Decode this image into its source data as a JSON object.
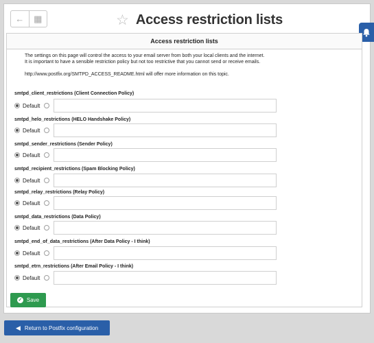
{
  "header": {
    "title": "Access restriction lists",
    "back_icon": "←",
    "grid_icon": "▦",
    "star_icon": "☆"
  },
  "colors": {
    "primary": "#2a5fa8",
    "success": "#2e9a4f"
  },
  "table": {
    "heading": "Access restriction lists",
    "intro": [
      "The settings on this page will control the access to your email server from both your local clients and the internet.",
      "It is important to have a sensible restriction policy but not too restrictive that you cannot send or receive emails."
    ],
    "readme": "http://www.postfix.org/SMTPD_ACCESS_README.html will offer more information on this topic."
  },
  "fields": [
    {
      "label": "smtpd_client_restrictions (Client Connection Policy)",
      "option": "Default",
      "selected": "default",
      "value": ""
    },
    {
      "label": "smtpd_helo_restrictions (HELO Handshake Policy)",
      "option": "Default",
      "selected": "default",
      "value": ""
    },
    {
      "label": "smtpd_sender_restrictions (Sender Policy)",
      "option": "Default",
      "selected": "default",
      "value": ""
    },
    {
      "label": "smtpd_recipient_restrictions (Spam Blocking Policy)",
      "option": "Default",
      "selected": "default",
      "value": ""
    },
    {
      "label": "smtpd_relay_restrictions (Relay Policy)",
      "option": "Default",
      "selected": "default",
      "value": ""
    },
    {
      "label": "smtpd_data_restrictions (Data Policy)",
      "option": "Default",
      "selected": "default",
      "value": ""
    },
    {
      "label": "smtpd_end_of_data_restrictions (After Data Policy - I think)",
      "option": "Default",
      "selected": "default",
      "value": ""
    },
    {
      "label": "smtpd_etrn_restrictions (After Email Policy - I think)",
      "option": "Default",
      "selected": "default",
      "value": ""
    }
  ],
  "actions": {
    "save_label": "Save",
    "return_label": "Return to Postfix configuration"
  }
}
